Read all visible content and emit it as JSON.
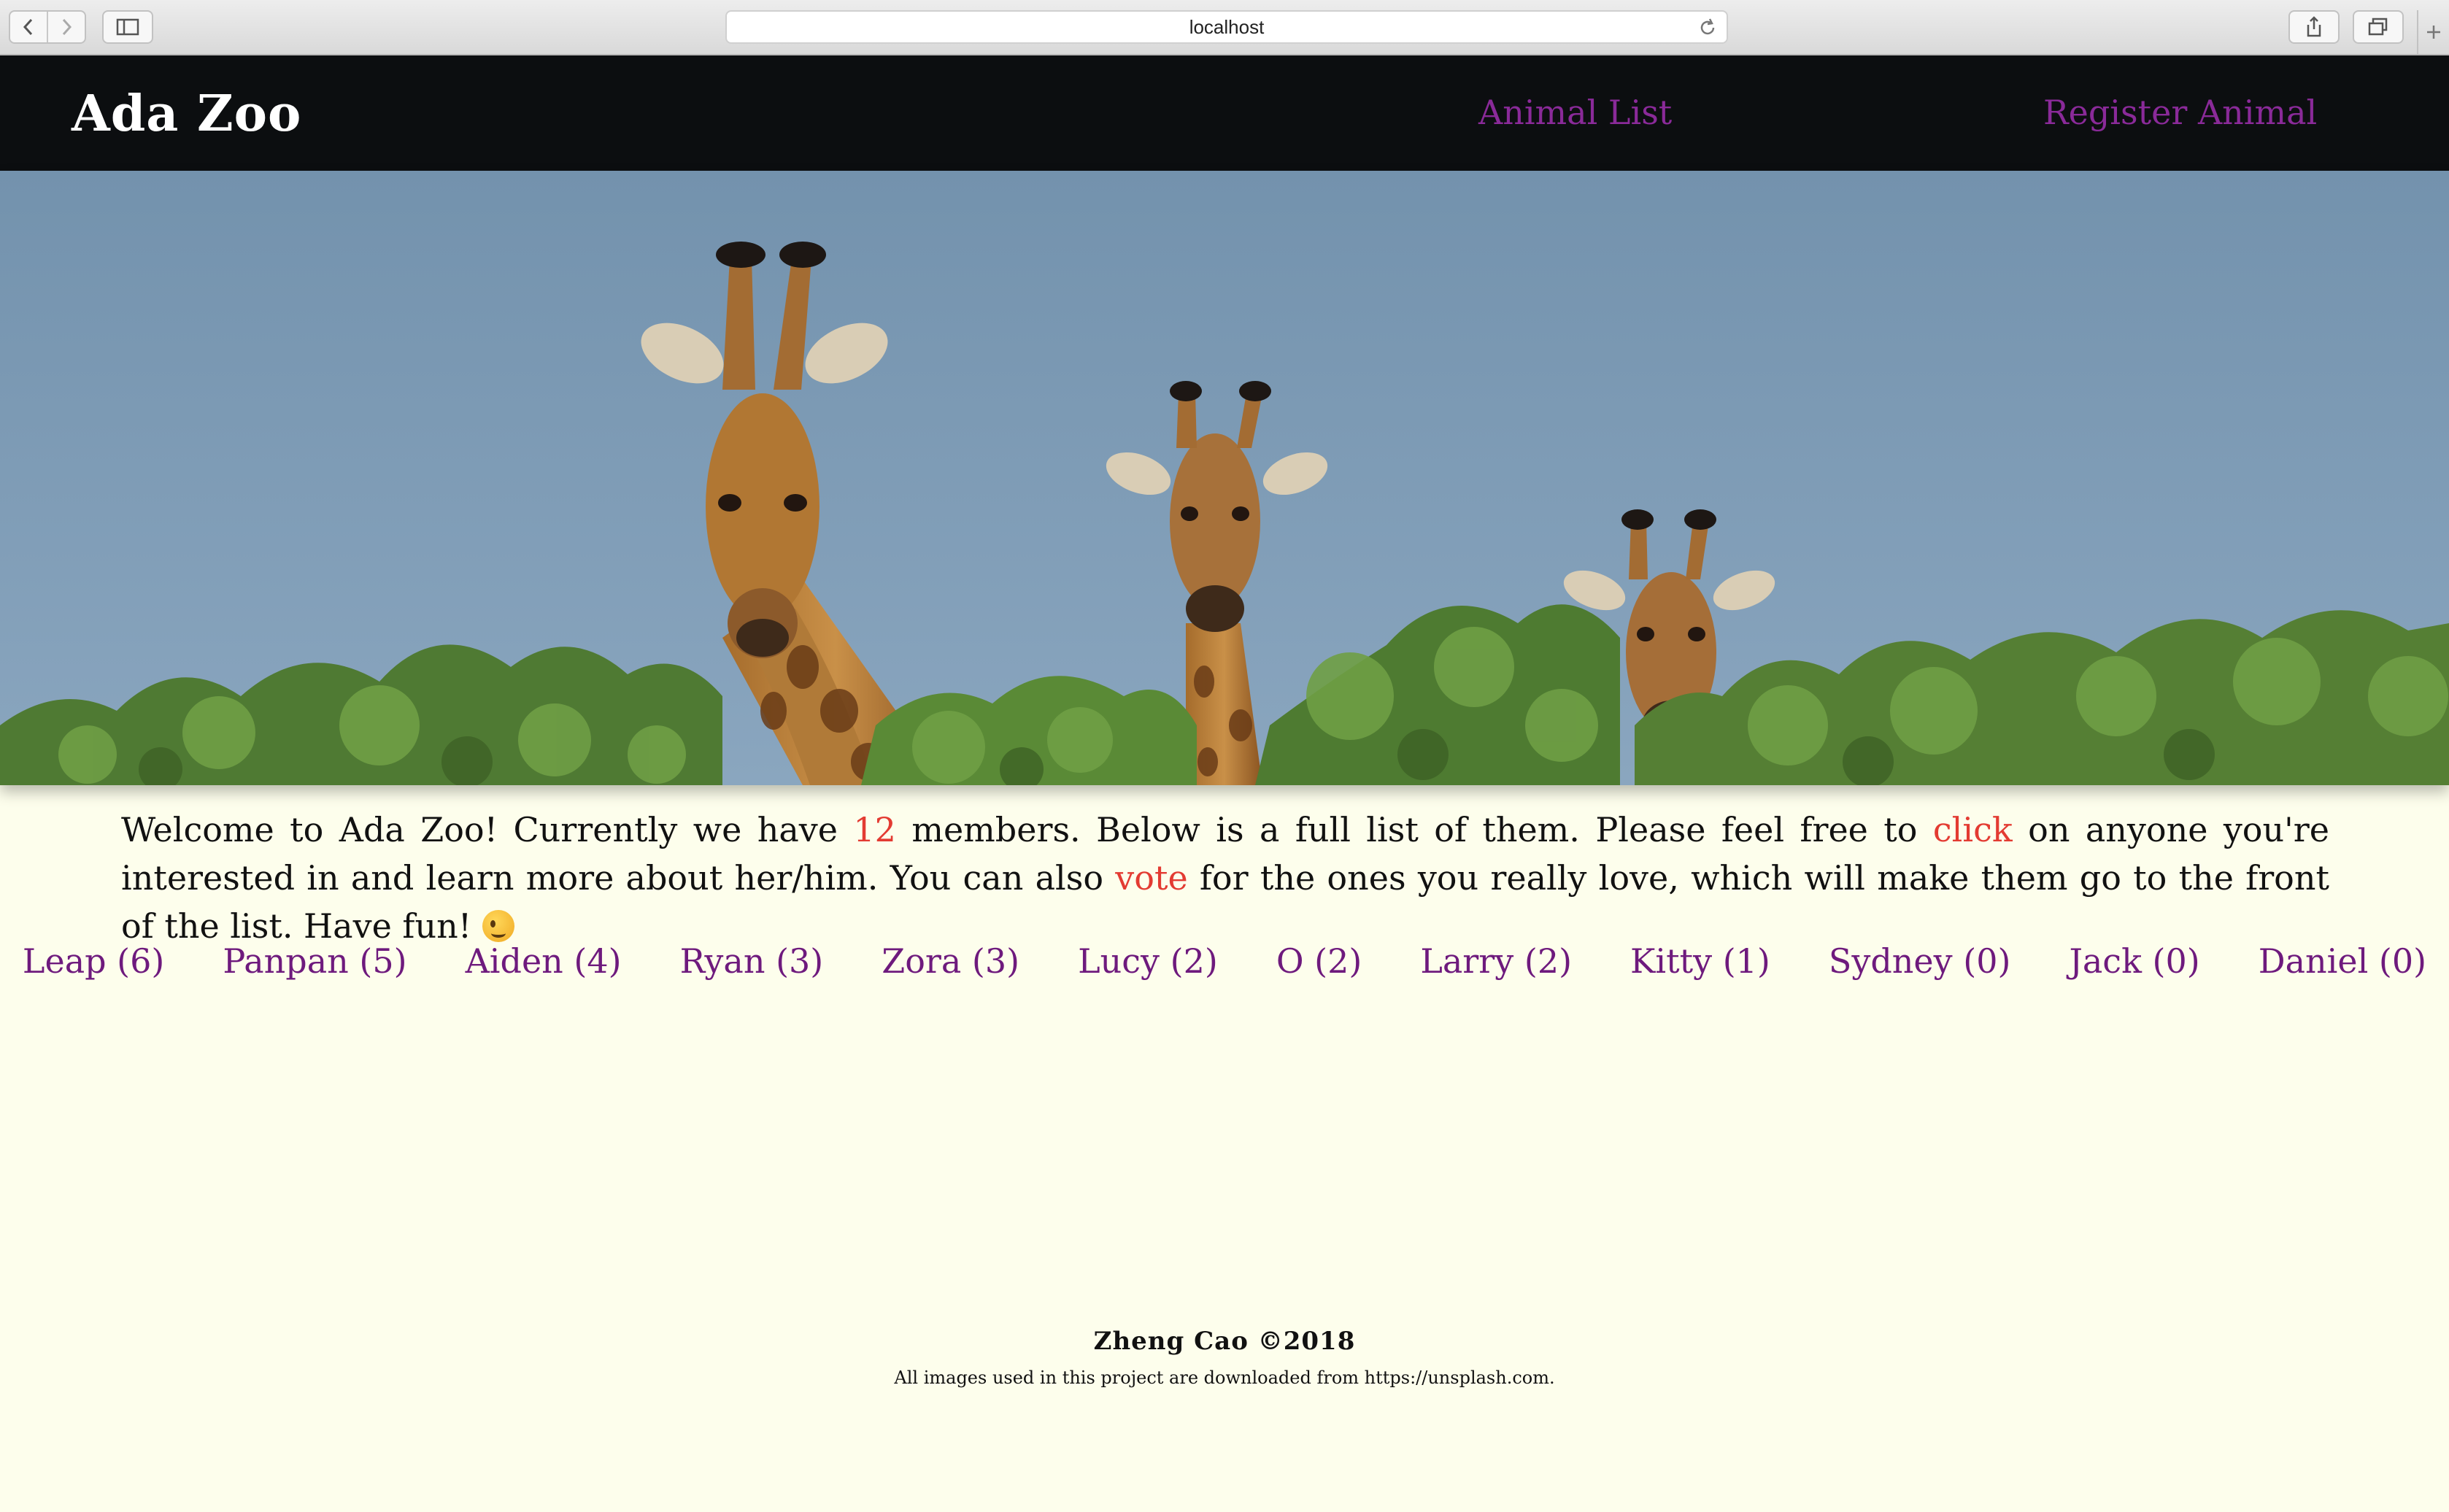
{
  "browser": {
    "url": "localhost"
  },
  "header": {
    "brand": "Ada Zoo",
    "nav": [
      {
        "label": "Animal List"
      },
      {
        "label": "Register Animal"
      }
    ]
  },
  "hero": {
    "image": "giraffes-over-trees"
  },
  "intro": {
    "part1": "Welcome to Ada Zoo! Currently we have ",
    "count": "12",
    "part2": " members. Below is a full list of them. Please feel free to ",
    "click": "click",
    "part3": " on anyone you're interested in and learn more about her/him. You can also ",
    "vote": "vote",
    "part4": " for the ones you really love, which will make them go to the front of the list. Have fun! ",
    "emoji": "winking-face-icon"
  },
  "animals": [
    "Leap (6)",
    "Panpan (5)",
    "Aiden (4)",
    "Ryan (3)",
    "Zora (3)",
    "Lucy (2)",
    "O (2)",
    "Larry (2)",
    "Kitty (1)",
    "Sydney (0)",
    "Jack (0)",
    "Daniel (0)"
  ],
  "footer": {
    "copyright": "Zheng Cao ©2018",
    "credit": "All images used in this project are downloaded from https://unsplash.com."
  },
  "colors": {
    "background": "#fdfeec",
    "header": "#0c0e10",
    "link": "#8a2a99",
    "highlight": "#e33b32"
  }
}
